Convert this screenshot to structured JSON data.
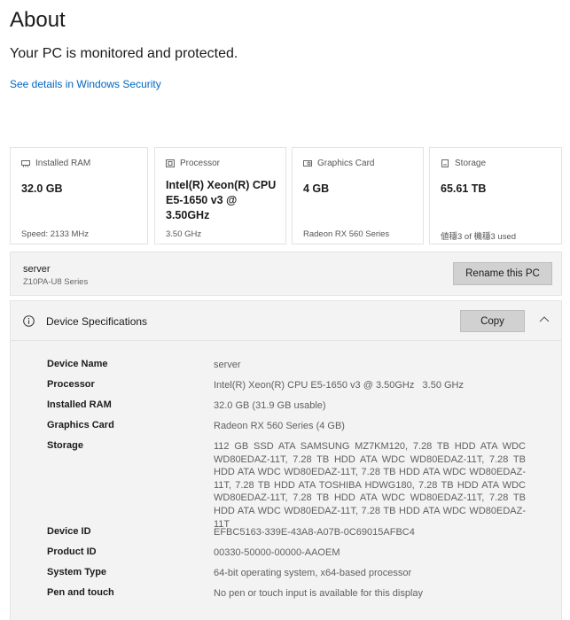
{
  "page": {
    "title": "About",
    "protection_status": "Your PC is monitored and protected.",
    "security_link": "See details in Windows Security"
  },
  "cards": [
    {
      "icon": "ram-icon",
      "label": "Installed RAM",
      "value": "32.0 GB",
      "sub": "Speed: 2133 MHz"
    },
    {
      "icon": "processor-icon",
      "label": "Processor",
      "value": "Intel(R) Xeon(R) CPU E5-1650 v3 @ 3.50GHz",
      "sub": "3.50 GHz"
    },
    {
      "icon": "graphics-card-icon",
      "label": "Graphics Card",
      "value": "4 GB",
      "sub": "Radeon RX 560 Series"
    },
    {
      "icon": "storage-icon",
      "label": "Storage",
      "value": "65.61 TB",
      "sub": "値穩3 of 機穩3 used"
    }
  ],
  "pc": {
    "name": "server",
    "model": "Z10PA-U8 Series",
    "rename_label": "Rename this PC"
  },
  "specs": {
    "title": "Device Specifications",
    "copy_label": "Copy",
    "rows": [
      {
        "label": "Device Name",
        "value": "server"
      },
      {
        "label": "Processor",
        "value": "Intel(R) Xeon(R) CPU E5-1650 v3 @ 3.50GHz   3.50 GHz"
      },
      {
        "label": "Installed RAM",
        "value": "32.0 GB (31.9 GB usable)"
      },
      {
        "label": "Graphics Card",
        "value": "Radeon RX 560 Series (4 GB)"
      },
      {
        "label": "Storage",
        "value": "112 GB SSD ATA SAMSUNG MZ7KM120, 7.28 TB HDD ATA WDC WD80EDAZ-11T, 7.28 TB HDD ATA WDC WD80EDAZ-11T, 7.28 TB HDD ATA WDC WD80EDAZ-11T, 7.28 TB HDD ATA WDC WD80EDAZ-11T, 7.28 TB HDD ATA TOSHIBA HDWG180, 7.28 TB HDD ATA WDC WD80EDAZ-11T, 7.28 TB HDD ATA WDC WD80EDAZ-11T, 7.28 TB HDD ATA WDC WD80EDAZ-11T, 7.28 TB HDD ATA WDC WD80EDAZ-11T"
      },
      {
        "label": "Device ID",
        "value": "EFBC5163-339E-43A8-A07B-0C69015AFBC4"
      },
      {
        "label": "Product ID",
        "value": "00330-50000-00000-AAOEM"
      },
      {
        "label": "System Type",
        "value": "64-bit operating system, x64-based processor"
      },
      {
        "label": "Pen and touch",
        "value": "No pen or touch input is available for this display"
      }
    ]
  },
  "colors": {
    "link": "#0067c0",
    "panel_background": "#f3f3f3",
    "button_background": "#d1d1d1"
  }
}
